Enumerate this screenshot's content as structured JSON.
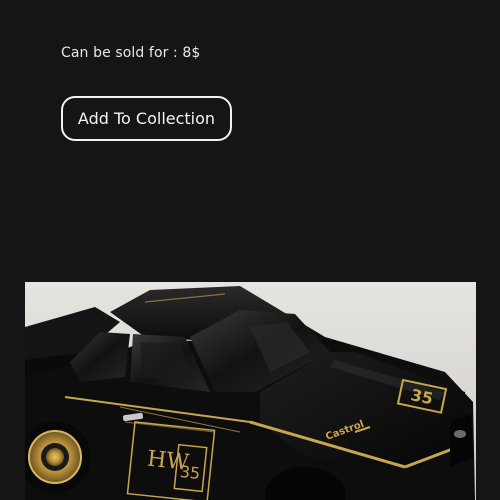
{
  "sale": {
    "price_text": "Can be sold for : 8$"
  },
  "actions": {
    "add_to_collection_label": "Add To Collection"
  },
  "car_image": {
    "description_icon": "toy-car-photo",
    "decal_number": "35",
    "brand_mark": "HW",
    "sponsor_text": "Castrol",
    "colors": {
      "body": "#0d0d0d",
      "gold": "#c9a54e",
      "background": "#dcdad6"
    }
  }
}
